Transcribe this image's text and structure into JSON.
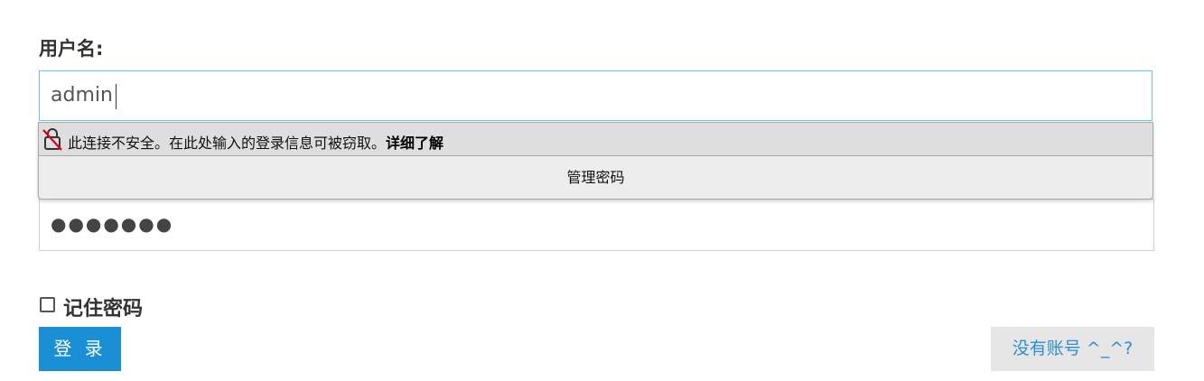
{
  "form": {
    "username_label": "用户名:",
    "username_value": "admin",
    "password_value": "●●●●●●●",
    "remember_label": "记住密码",
    "login_label": "登 录",
    "register_label": "没有账号 ^_^?"
  },
  "autofill": {
    "insecure_message": "此连接不安全。在此处输入的登录信息可被窃取。",
    "learn_more": "详细了解",
    "manage_passwords": "管理密码"
  },
  "colors": {
    "accent": "#1a8fd6",
    "focus_border": "#66c9ea",
    "insecure_lock": "#d70022"
  },
  "icons": {
    "insecure_lock": "insecure-lock-icon"
  }
}
